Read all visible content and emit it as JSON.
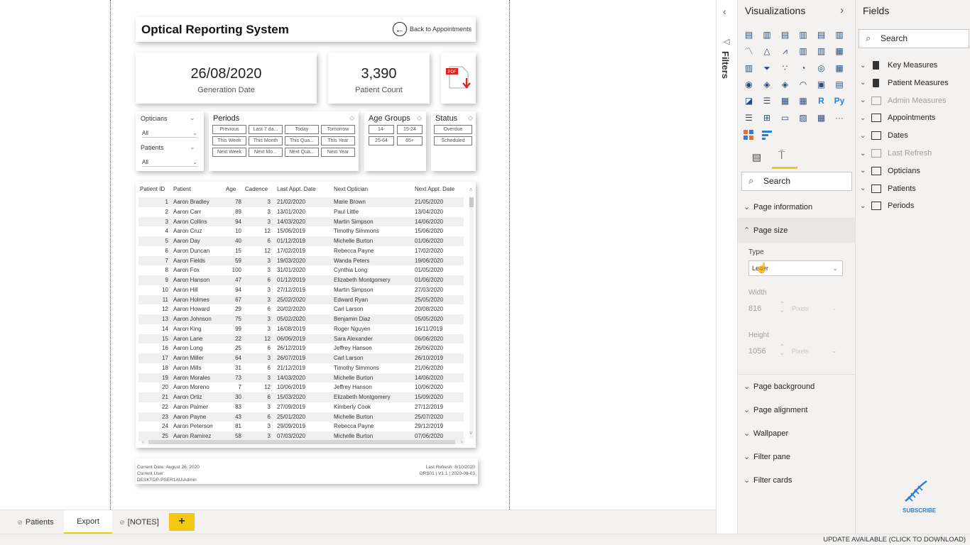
{
  "report": {
    "title": "Optical Reporting System",
    "back_label": "Back to Appointments",
    "generation_date": "26/08/2020",
    "generation_date_label": "Generation Date",
    "patient_count": "3,390",
    "patient_count_label": "Patient Count",
    "pdf_label": "PDF"
  },
  "slicers": {
    "opticians_label": "Opticians",
    "opticians_value": "All",
    "patients_label": "Patients",
    "patients_value": "All",
    "periods_label": "Periods",
    "periods_buttons": [
      "Previous",
      "Last 7 da...",
      "Today",
      "Tomorrow",
      "This Week",
      "This Month",
      "This Qua...",
      "This Year",
      "Next Week",
      "Next Mo...",
      "Next Qua...",
      "Next Year"
    ],
    "age_groups_label": "Age Groups",
    "age_buttons": [
      "14-",
      "15-24",
      "25-64",
      "65+"
    ],
    "status_label": "Status",
    "status_buttons": [
      "Overdue",
      "Scheduled"
    ]
  },
  "table": {
    "headers": [
      "Patient ID",
      "Patient",
      "Age",
      "Cadence",
      "Last Appt. Date",
      "Next Optician",
      "Next Appt. Date"
    ],
    "rows": [
      [
        "1",
        "Aaron Bradley",
        "78",
        "3",
        "21/02/2020",
        "Marie Brown",
        "21/05/2020"
      ],
      [
        "2",
        "Aaron Carr",
        "89",
        "3",
        "13/01/2020",
        "Paul Little",
        "13/04/2020"
      ],
      [
        "3",
        "Aaron Collins",
        "94",
        "3",
        "14/03/2020",
        "Martin Simpson",
        "14/06/2020"
      ],
      [
        "4",
        "Aaron Cruz",
        "10",
        "12",
        "15/06/2019",
        "Timothy Simmons",
        "15/06/2020"
      ],
      [
        "5",
        "Aaron Day",
        "40",
        "6",
        "01/12/2019",
        "Michelle Burton",
        "01/06/2020"
      ],
      [
        "6",
        "Aaron Duncan",
        "15",
        "12",
        "17/02/2019",
        "Rebecca Payne",
        "17/02/2020"
      ],
      [
        "7",
        "Aaron Fields",
        "59",
        "3",
        "19/03/2020",
        "Wanda Peters",
        "19/06/2020"
      ],
      [
        "8",
        "Aaron Fox",
        "100",
        "3",
        "31/01/2020",
        "Cynthia Long",
        "01/05/2020"
      ],
      [
        "9",
        "Aaron Hanson",
        "47",
        "6",
        "01/12/2019",
        "Elizabeth Montgomery",
        "01/06/2020"
      ],
      [
        "10",
        "Aaron Hill",
        "94",
        "3",
        "27/12/2019",
        "Martin Simpson",
        "27/03/2020"
      ],
      [
        "11",
        "Aaron Holmes",
        "67",
        "3",
        "25/02/2020",
        "Edward Ryan",
        "25/05/2020"
      ],
      [
        "12",
        "Aaron Howard",
        "29",
        "6",
        "20/02/2020",
        "Carl Larson",
        "20/08/2020"
      ],
      [
        "13",
        "Aaron Johnson",
        "75",
        "3",
        "05/02/2020",
        "Benjamin Diaz",
        "05/05/2020"
      ],
      [
        "14",
        "Aaron King",
        "99",
        "3",
        "16/08/2019",
        "Roger Nguyen",
        "16/11/2019"
      ],
      [
        "15",
        "Aaron Lane",
        "22",
        "12",
        "06/06/2019",
        "Sara Alexander",
        "06/06/2020"
      ],
      [
        "16",
        "Aaron Long",
        "25",
        "6",
        "26/12/2019",
        "Jeffrey Hanson",
        "26/06/2020"
      ],
      [
        "17",
        "Aaron Miller",
        "64",
        "3",
        "26/07/2019",
        "Carl Larson",
        "26/10/2019"
      ],
      [
        "18",
        "Aaron Mills",
        "31",
        "6",
        "21/12/2019",
        "Timothy Simmons",
        "21/06/2020"
      ],
      [
        "19",
        "Aaron Morales",
        "73",
        "3",
        "14/03/2020",
        "Michelle Burton",
        "14/06/2020"
      ],
      [
        "20",
        "Aaron Moreno",
        "7",
        "12",
        "10/06/2019",
        "Jeffrey Hanson",
        "10/06/2020"
      ],
      [
        "21",
        "Aaron Ortiz",
        "30",
        "6",
        "15/03/2020",
        "Elizabeth Montgomery",
        "15/09/2020"
      ],
      [
        "22",
        "Aaron Palmer",
        "83",
        "3",
        "27/09/2019",
        "Kimberly Cook",
        "27/12/2019"
      ],
      [
        "23",
        "Aaron Payne",
        "43",
        "6",
        "25/01/2020",
        "Michelle Burton",
        "25/07/2020"
      ],
      [
        "24",
        "Aaron Peterson",
        "81",
        "3",
        "29/09/2019",
        "Rebecca Payne",
        "29/12/2019"
      ],
      [
        "25",
        "Aaron Ramirez",
        "58",
        "3",
        "07/03/2020",
        "Michelle Burton",
        "07/06/2020"
      ]
    ]
  },
  "footer": {
    "current_date": "Current Date: August 26, 2020",
    "current_user": "Current User:",
    "user_value": "DESKTOP-PSER1AU\\Admin",
    "last_refresh": "Last Refresh: 8/10/2020",
    "version": "ORS01 | V1.1 | 2020-08-03"
  },
  "page_tabs": [
    "Patients",
    "Export",
    "[NOTES]"
  ],
  "active_tab": "Export",
  "add_page_label": "+",
  "status_bar": "UPDATE AVAILABLE (CLICK TO DOWNLOAD)",
  "filters_pane": {
    "label": "Filters"
  },
  "visualizations": {
    "title": "Visualizations",
    "search_placeholder": "Search",
    "sections": [
      "Page information",
      "Page size",
      "Page background",
      "Page alignment",
      "Wallpaper",
      "Filter pane",
      "Filter cards"
    ],
    "page_size": {
      "type_label": "Type",
      "type_value": "Letter",
      "width_label": "Width",
      "width_value": "816",
      "height_label": "Height",
      "height_value": "1056",
      "unit": "Pixels"
    },
    "r_label": "R",
    "py_label": "Py",
    "more_label": "···"
  },
  "fields": {
    "title": "Fields",
    "search_placeholder": "Search",
    "items": [
      {
        "label": "Key Measures",
        "type": "calc",
        "dim": false
      },
      {
        "label": "Patient Measures",
        "type": "calc",
        "dim": false
      },
      {
        "label": "Admin Measures",
        "type": "table",
        "dim": true
      },
      {
        "label": "Appointments",
        "type": "table",
        "dim": false
      },
      {
        "label": "Dates",
        "type": "table",
        "dim": false
      },
      {
        "label": "Last Refresh",
        "type": "table",
        "dim": true
      },
      {
        "label": "Opticians",
        "type": "table",
        "dim": false
      },
      {
        "label": "Patients",
        "type": "table",
        "dim": false
      },
      {
        "label": "Periods",
        "type": "table",
        "dim": false
      }
    ]
  },
  "subscribe_label": "SUBSCRIBE",
  "colors": {
    "accent": "#f2c811",
    "pane": "#f3f2f1",
    "pdf_red": "#e0201d",
    "subscribe": "#2b7fd6"
  }
}
